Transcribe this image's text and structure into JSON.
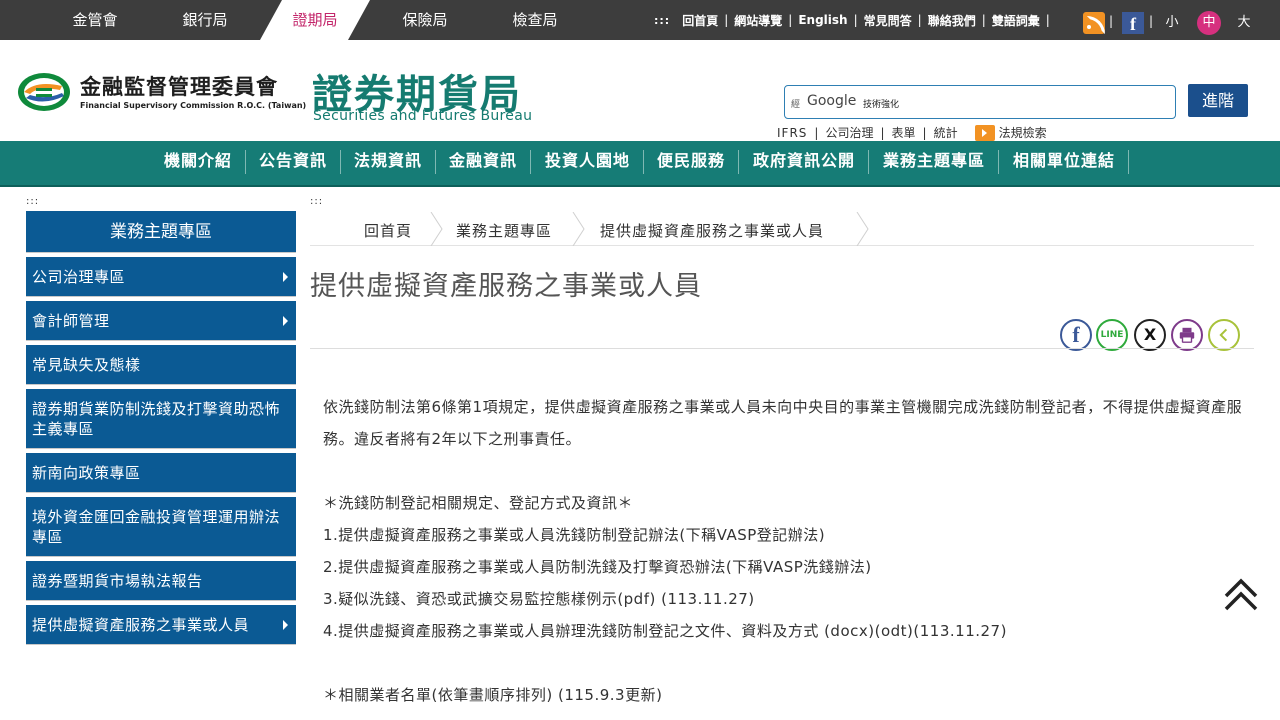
{
  "top": {
    "agencies": [
      "金管會",
      "銀行局",
      "證期局",
      "保險局",
      "檢查局"
    ],
    "active_agency": "證期局",
    "links_dots": ":::",
    "links": [
      "回首頁",
      "網站導覽",
      "English",
      "常見問答",
      "聯絡我們",
      "雙語詞彙"
    ],
    "link_sep": "|",
    "font_sizes": [
      "小",
      "中",
      "大"
    ],
    "selected_font_size": "中",
    "facebook_glyph": "f"
  },
  "header": {
    "fsc_name": "金融監督管理委員會",
    "fsc_name_en": "Financial Supervisory Commission R.O.C. (Taiwan)",
    "bureau_name": "證券期貨局",
    "bureau_name_en": "Securities and Futures Bureau",
    "search_prefix": "經",
    "search_brand": "Google",
    "search_value": "技術強化",
    "advanced_label": "進階",
    "quick_links": [
      "IFRS",
      "公司治理",
      "表單",
      "統計"
    ],
    "law_search_label": "法規檢索"
  },
  "nav": {
    "items": [
      "機關介紹",
      "公告資訊",
      "法規資訊",
      "金融資訊",
      "投資人園地",
      "便民服務",
      "政府資訊公開",
      "業務主題專區",
      "相關單位連結"
    ]
  },
  "sidebar": {
    "dots": ":::",
    "title": "業務主題專區",
    "items": [
      {
        "label": "公司治理專區",
        "arrow": true
      },
      {
        "label": "會計師管理",
        "arrow": true
      },
      {
        "label": "常見缺失及態樣",
        "arrow": false
      },
      {
        "label": "證券期貨業防制洗錢及打擊資助恐怖主義專區",
        "arrow": false
      },
      {
        "label": "新南向政策專區",
        "arrow": false
      },
      {
        "label": "境外資金匯回金融投資管理運用辦法專區",
        "arrow": false
      },
      {
        "label": "證券暨期貨市場執法報告",
        "arrow": false
      },
      {
        "label": "提供虛擬資產服務之事業或人員",
        "arrow": true
      }
    ]
  },
  "content": {
    "dots": ":::",
    "breadcrumb": [
      "回首頁",
      "業務主題專區",
      "提供虛擬資產服務之事業或人員"
    ],
    "title": "提供虛擬資產服務之事業或人員",
    "share": {
      "facebook": "f",
      "line": "LINE",
      "x": "X",
      "print": "print",
      "back": "back"
    },
    "paragraph": "依洗錢防制法第6條第1項規定，提供虛擬資產服務之事業或人員未向中央目的事業主管機關完成洗錢防制登記者，不得提供虛擬資產服務。違反者將有2年以下之刑事責任。",
    "section1_title": "＊洗錢防制登記相關規定、登記方式及資訊＊",
    "section1_items": [
      "1.提供虛擬資產服務之事業或人員洗錢防制登記辦法(下稱VASP登記辦法)",
      "2.提供虛擬資產服務之事業或人員防制洗錢及打擊資恐辦法(下稱VASP洗錢辦法)",
      "3.疑似洗錢、資恐或武擴交易監控態樣例示(pdf) (113.11.27)",
      "4.提供虛擬資產服務之事業或人員辦理洗錢防制登記之文件、資料及方式 (docx)(odt)(113.11.27)"
    ],
    "section2_title": "＊相關業者名單(依筆畫順序排列) (115.9.3更新)"
  },
  "colors": {
    "topbar": "#3d3d3d",
    "nav": "#167c76",
    "sidebar": "#0b5a94",
    "active_agency": "#c3256a",
    "brand_green": "#157b70",
    "accent_orange": "#f29223"
  }
}
